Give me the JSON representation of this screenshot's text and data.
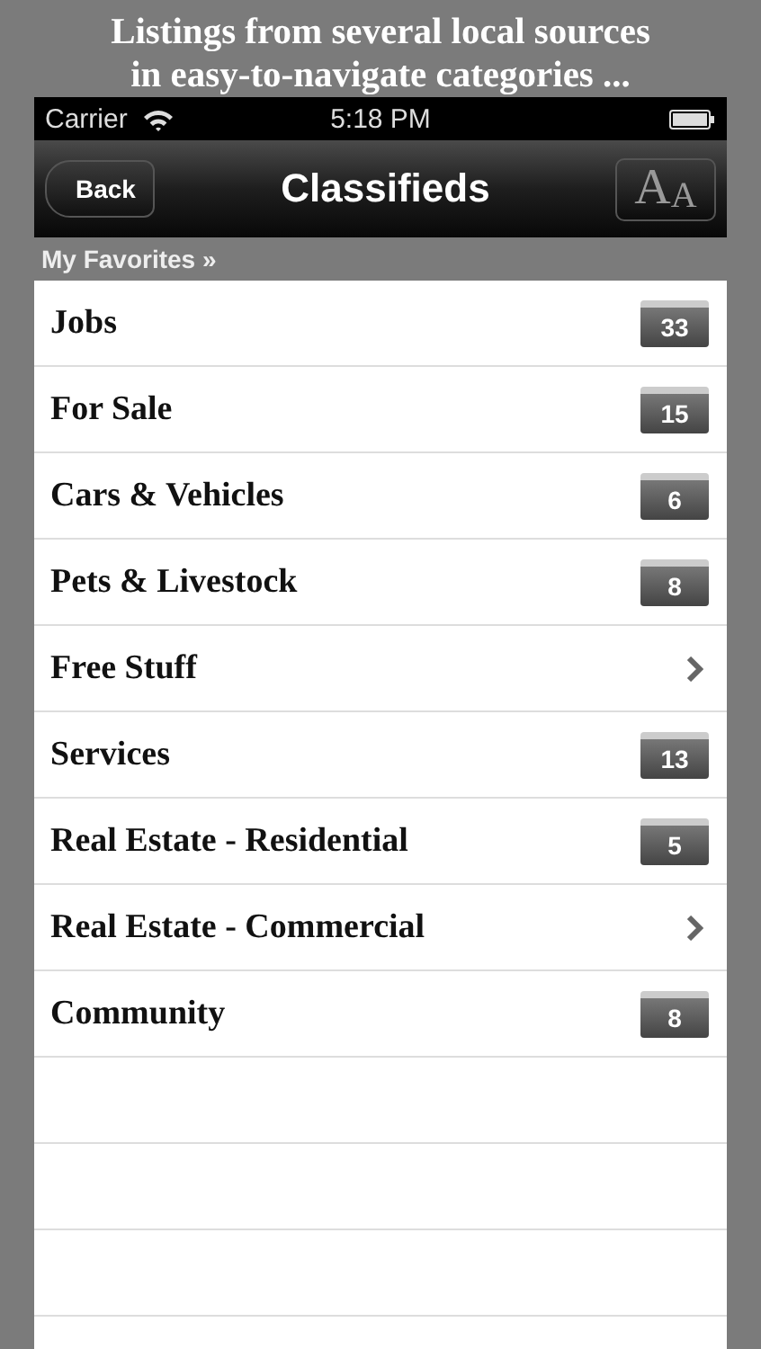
{
  "caption": [
    "Listings from several local sources",
    "in easy-to-navigate categories ..."
  ],
  "status_bar": {
    "carrier": "Carrier",
    "time": "5:18 PM"
  },
  "nav_bar": {
    "back": "Back",
    "title": "Classifieds",
    "font_button": [
      "A",
      "A"
    ]
  },
  "section_header": "My Favorites »",
  "categories": [
    {
      "label": "Jobs",
      "kind": "folder",
      "count": "33"
    },
    {
      "label": "For Sale",
      "kind": "folder",
      "count": "15"
    },
    {
      "label": "Cars & Vehicles",
      "kind": "folder",
      "count": "6"
    },
    {
      "label": "Pets & Livestock",
      "kind": "folder",
      "count": "8"
    },
    {
      "label": "Free Stuff",
      "kind": "chevron"
    },
    {
      "label": "Services",
      "kind": "folder",
      "count": "13"
    },
    {
      "label": "Real Estate - Residential",
      "kind": "folder",
      "count": "5"
    },
    {
      "label": "Real Estate - Commercial",
      "kind": "chevron"
    },
    {
      "label": "Community",
      "kind": "folder",
      "count": "8"
    }
  ]
}
